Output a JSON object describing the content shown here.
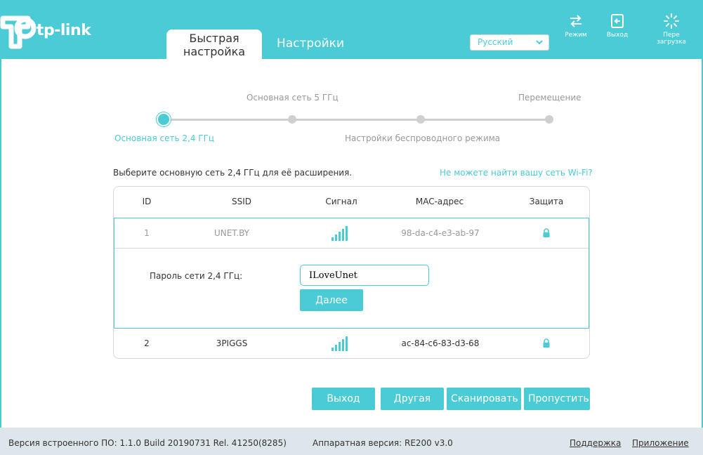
{
  "brand": {
    "logo_text": "tp-link",
    "color": "#4acbd6"
  },
  "tabs": {
    "quick_line1": "Быстрая",
    "quick_line2": "настройка",
    "settings": "Настройки"
  },
  "language": {
    "selected": "Русский"
  },
  "header_buttons": {
    "mode": {
      "label": "Режим",
      "icon": "mode-switch-icon"
    },
    "logout": {
      "label": "Выход",
      "icon": "logout-icon"
    },
    "reboot": {
      "label": "Пере загрузка",
      "icon": "reboot-icon"
    }
  },
  "steps": [
    {
      "label": "Основная сеть 2,4 ГГц",
      "active": true
    },
    {
      "label": "Основная сеть 5 ГГц",
      "active": false
    },
    {
      "label": "Настройки беспроводного режима",
      "active": false
    },
    {
      "label": "Перемещение",
      "active": false
    }
  ],
  "intro": "Выберите основную сеть 2,4 ГГц для её расширения.",
  "cant_find_link": "Не можете найти вашу сеть Wi-Fi?",
  "table": {
    "headers": {
      "id": "ID",
      "ssid": "SSID",
      "signal": "Сигнал",
      "mac": "MAC-адрес",
      "security": "Защита"
    },
    "rows": [
      {
        "id": "1",
        "ssid": "UNET.BY",
        "signal_bars": 5,
        "mac": "98-da-c4-e3-ab-97",
        "secured": true
      },
      {
        "id": "2",
        "ssid": "3PIGGS",
        "signal_bars": 5,
        "mac": "ac-84-c6-83-d3-68",
        "secured": true
      }
    ],
    "password_label": "Пароль сети 2,4 ГГц:",
    "password_value": "ILoveUnet",
    "next_button": "Далее"
  },
  "actions": {
    "exit": "Выход",
    "other": "Другая",
    "scan": "Сканировать",
    "skip": "Пропустить"
  },
  "footer": {
    "firmware": "Версия встроенного ПО: 1.1.0 Build 20190731 Rel. 41250(8285)",
    "hardware": "Аппаратная версия: RE200 v3.0",
    "support": "Поддержка",
    "app": "Приложение"
  }
}
